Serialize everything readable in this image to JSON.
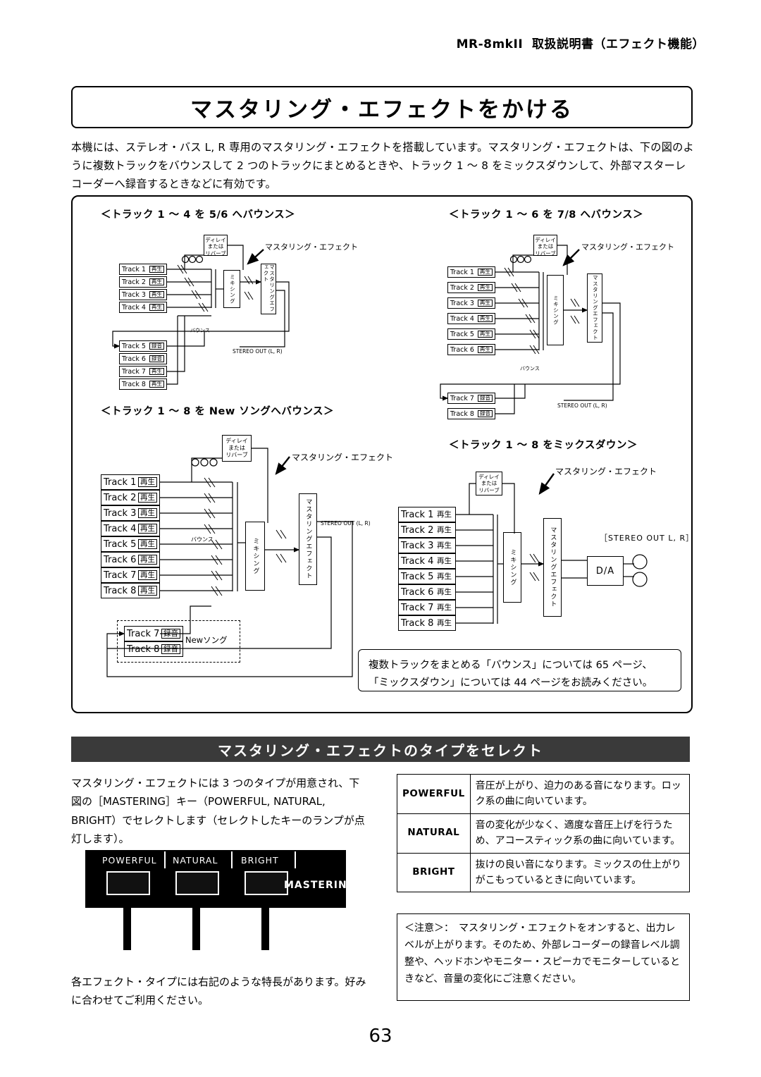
{
  "header": {
    "model": "MR-8mk",
    "model_suffix": "II",
    "title": "取扱説明書（エフェクト機能）"
  },
  "page_title": "マスタリング・エフェクトをかける",
  "intro": "本機には、ステレオ・バス L, R 専用のマスタリング・エフェクトを搭載しています。マスタリング・エフェクトは、下の図のように複数トラックをバウンスして 2 つのトラックにまとめるときや、トラック 1 ～ 8 をミックスダウンして、外部マスターレコーダーへ録音するときなどに有効です。",
  "diagrams": {
    "d1": {
      "caption": "＜トラック 1 ～ 4 を 5/6 へバウンス＞",
      "effect_label": "マスタリング・エフェクト",
      "delay_label": "ディレイ\nまたは\nリバーブ",
      "mix_label": "ミキシング",
      "mastering_label": "マスタリングエフェクト",
      "bounce_label": "バウンス",
      "stereo_out": "STEREO OUT (L, R)",
      "play": "再生",
      "rec": "録音",
      "tracks_play": [
        "Track 1",
        "Track 2",
        "Track 3",
        "Track 4"
      ],
      "tracks_rec": [
        "Track 5",
        "Track 6"
      ],
      "tracks_play2": [
        "Track 7",
        "Track 8"
      ]
    },
    "d2": {
      "caption": "＜トラック 1 ～ 6 を 7/8 へバウンス＞",
      "effect_label": "マスタリング・エフェクト",
      "delay_label": "ディレイ\nまたは\nリバーブ",
      "mix_label": "ミキシング",
      "mastering_label": "マスタリングエフェクト",
      "bounce_label": "バウンス",
      "stereo_out": "STEREO OUT (L, R)",
      "play": "再生",
      "rec": "録音",
      "tracks_play": [
        "Track 1",
        "Track 2",
        "Track 3",
        "Track 4",
        "Track 5",
        "Track 6"
      ],
      "tracks_rec": [
        "Track 7",
        "Track 8"
      ]
    },
    "d3": {
      "caption": "＜トラック 1 ～ 8 を New ソングへバウンス＞",
      "effect_label": "マスタリング・エフェクト",
      "delay_label": "ディレイ\nまたは\nリバーブ",
      "mix_label": "ミキシング",
      "mastering_label": "マスタリングエフェクト",
      "bounce_label": "バウンス",
      "stereo_out": "STEREO OUT (L, R)",
      "newsong_label": "Newソング",
      "play": "再生",
      "rec": "録音",
      "tracks_play": [
        "Track 1",
        "Track 2",
        "Track 3",
        "Track 4",
        "Track 5",
        "Track 6",
        "Track 7",
        "Track 8"
      ],
      "tracks_rec": [
        "Track 7",
        "Track 8"
      ]
    },
    "d4": {
      "caption": "＜トラック 1 ～ 8 をミックスダウン＞",
      "effect_label": "マスタリング・エフェクト",
      "delay_label": "ディレイ\nまたは\nリバーブ",
      "mix_label": "ミキシング",
      "mastering_label": "マスタリングエフェクト",
      "stereo_out": "［STEREO OUT L, R］",
      "da_label": "D/A",
      "play": "再生",
      "tracks_play": [
        "Track 1",
        "Track 2",
        "Track 3",
        "Track 4",
        "Track 5",
        "Track 6",
        "Track 7",
        "Track 8"
      ]
    },
    "note": "複数トラックをまとめる「バウンス」については 65 ページ、\n「ミックスダウン」については 44 ページをお読みください。"
  },
  "section": {
    "bar_title": "マスタリング・エフェクトのタイプをセレクト"
  },
  "left_text_1": "マスタリング・エフェクトには 3 つのタイプが用意され、下図の［MASTERING］キー（POWERFUL, NATURAL, BRIGHT）でセレクトします（セレクトしたキーのランプが点灯します）。",
  "left_text_2": "各エフェクト・タイプには右記のような特長があります。好みに合わせてご利用ください。",
  "panel": {
    "keys": [
      "POWERFUL",
      "NATURAL",
      "BRIGHT"
    ],
    "group_label": "MASTERING"
  },
  "table": {
    "rows": [
      {
        "key": "POWERFUL",
        "desc": "音圧が上がり、迫力のある音になります。ロック系の曲に向いています。"
      },
      {
        "key": "NATURAL",
        "desc": "音の変化が少なく、適度な音圧上げを行うため、アコースティック系の曲に向いています。"
      },
      {
        "key": "BRIGHT",
        "desc": "抜けの良い音になります。ミックスの仕上がりがこもっているときに向いています。"
      }
    ]
  },
  "caution": "＜注意＞：　マスタリング・エフェクトをオンすると、出力レベルが上がります。そのため、外部レコーダーの録音レベル調整や、ヘッドホンやモニター・スピーカでモニターしているときなど、音量の変化にご注意ください。",
  "page_number": "63"
}
